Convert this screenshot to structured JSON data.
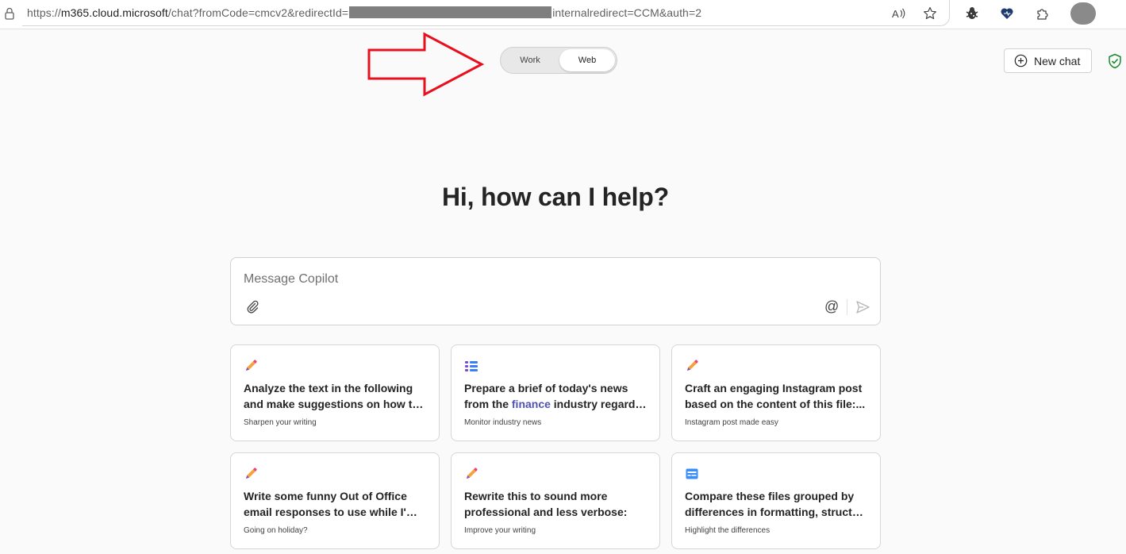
{
  "browser": {
    "url_scheme": "https://",
    "url_host": "m365.cloud.microsoft",
    "url_path": "/chat?fromCode=cmcv2&redirectId=",
    "url_tail": "internalredirect=CCM&auth=2",
    "icons": [
      "lock-icon",
      "read-aloud-icon",
      "favorite-star-icon",
      "extension-bug-icon",
      "heart-extension-icon",
      "puzzle-extensions-icon",
      "profile-avatar"
    ]
  },
  "toggle": {
    "work_label": "Work",
    "web_label": "Web",
    "selected": "Web"
  },
  "header": {
    "new_chat_label": "New chat"
  },
  "main": {
    "heading": "Hi, how can I help?",
    "composer": {
      "placeholder": "Message Copilot",
      "mention_symbol": "@"
    }
  },
  "cards": [
    {
      "icon": "pencil-icon",
      "line1": "Analyze the text in the following",
      "line2": "and make suggestions on how to...",
      "subtitle": "Sharpen your writing"
    },
    {
      "icon": "list-icon",
      "line1": "Prepare a brief of today's news",
      "line2_pre": "from the ",
      "line2_hl": "finance",
      "line2_post": " industry regardi...",
      "subtitle": "Monitor industry news"
    },
    {
      "icon": "pencil-icon",
      "line1": "Craft an engaging Instagram post",
      "line2": "based on the content of this file:...",
      "subtitle": "Instagram post made easy"
    },
    {
      "icon": "pencil-icon",
      "line1": "Write some funny Out of Office",
      "line2": "email responses to use while I'm o...",
      "subtitle": "Going on holiday?"
    },
    {
      "icon": "pencil-icon",
      "line1": "Rewrite this to sound more",
      "line2": "professional and less verbose:",
      "subtitle": "Improve your writing"
    },
    {
      "icon": "table-icon",
      "line1": "Compare these files grouped by",
      "line2": "differences in formatting, structur...",
      "subtitle": "Highlight the differences"
    }
  ],
  "colors": {
    "accent": "#4f52b2",
    "annotation_arrow": "#e8101e",
    "shield": "#1a8a2e"
  }
}
